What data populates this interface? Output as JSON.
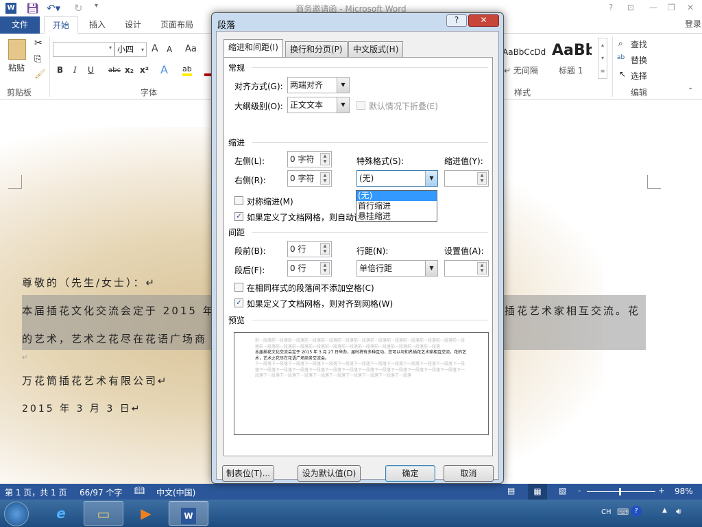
{
  "window": {
    "title": "商务邀请函 - Microsoft Word",
    "controls": [
      "?",
      "⊡",
      "—",
      "❐",
      "✕"
    ],
    "login": "登录"
  },
  "tabs": {
    "file": "文件",
    "items": [
      "开始",
      "插入",
      "设计",
      "页面布局"
    ]
  },
  "ribbon": {
    "clipboard": {
      "paste": "粘贴",
      "label": "剪贴板"
    },
    "font": {
      "name": "",
      "size": "小四",
      "grow": "A",
      "shrink": "A",
      "case": "Aa",
      "bold": "B",
      "italic": "I",
      "underline": "U",
      "strike": "abc",
      "sub": "x₂",
      "sup": "x²",
      "label": "字体"
    },
    "styles": {
      "s1_preview": "AaBbCcDd",
      "s1_name": "↵ 无间隔",
      "s2_preview": "AaBb",
      "s2_name": "标题 1",
      "label": "样式"
    },
    "editing": {
      "find": "查找",
      "replace": "替换",
      "select": "选择",
      "label": "编辑"
    }
  },
  "document": {
    "salutation": "尊敬的（先生/女士）：↵",
    "body_line1_left": "本届插花文化交流会定于 2015 年",
    "body_line1_right": "插花艺术家相互交流。花",
    "body_line2": "的艺术，艺术之花尽在花语广场商",
    "empty_mark": "↵",
    "company": "万花筒插花艺术有限公司↵",
    "date": "2015 年 3 月 3 日↵"
  },
  "dialog": {
    "title": "段落",
    "help": "?",
    "close": "✕",
    "tabs": [
      "缩进和间距(I)",
      "换行和分页(P)",
      "中文版式(H)"
    ],
    "general": {
      "heading": "常规",
      "alignment_label": "对齐方式(G):",
      "alignment_value": "两端对齐",
      "outline_label": "大纲级别(O):",
      "outline_value": "正文文本",
      "collapse_label": "默认情况下折叠(E)",
      "collapse_checked": false
    },
    "indent": {
      "heading": "缩进",
      "left_label": "左侧(L):",
      "left_value": "0 字符",
      "right_label": "右侧(R):",
      "right_value": "0 字符",
      "special_label": "特殊格式(S):",
      "special_value": "(无)",
      "special_options": [
        "(无)",
        "首行缩进",
        "悬挂缩进"
      ],
      "by_label": "缩进值(Y):",
      "by_value": "",
      "mirror_label": "对称缩进(M)",
      "mirror_checked": false,
      "grid_label": "如果定义了文档网格，则自动调整右缩进(D)",
      "grid_checked": true
    },
    "spacing": {
      "heading": "间距",
      "before_label": "段前(B):",
      "before_value": "0 行",
      "after_label": "段后(F):",
      "after_value": "0 行",
      "line_label": "行距(N):",
      "line_value": "单倍行距",
      "at_label": "设置值(A):",
      "at_value": "",
      "nospace_label": "在相同样式的段落间不添加空格(C)",
      "nospace_checked": false,
      "snap_label": "如果定义了文档网格，则对齐到网格(W)",
      "snap_checked": true
    },
    "preview": {
      "heading": "预览",
      "prev_text": "前一段落前一段落前一段落前一段落前一段落前一段落前一段落前一段落前一段落前一段落前一段落前一段落前一段落前一段落前一段落前一段落前一段落前一段落前一段落前一段落前一段落前一段落前一段落前一段落",
      "main_text": "本届插花文化交流会定于 2015 年 3 月 27 日举办，届时将有多种互动，您可以与知名插花艺术家相互交流。花的艺术，艺术之花尽在花语广场商务交流会。",
      "next_text": "下一段落下一段落下一段落下一段落下一段落下一段落下一段落下一段落下一段落下一段落下一段落下一段落下一段落下一段落下一段落下一段落下一段落下一段落下一段落下一段落下一段落下一段落下一段落下一段落下一段落下一段落下一段落下一段落下一段落下一段落下一段落下一段落下一段落下一段落下一段落"
    },
    "buttons": {
      "tabs": "制表位(T)...",
      "default": "设为默认值(D)",
      "ok": "确定",
      "cancel": "取消"
    }
  },
  "status": {
    "page": "第 1 页，共 1 页",
    "words": "66/97 个字",
    "language": "中文(中国)",
    "zoom": "98%",
    "zoom_minus": "-",
    "zoom_plus": "+"
  },
  "taskbar": {
    "tray": "CH"
  },
  "colors": {
    "accent": "#2b579a",
    "selection": "#3399ff"
  }
}
